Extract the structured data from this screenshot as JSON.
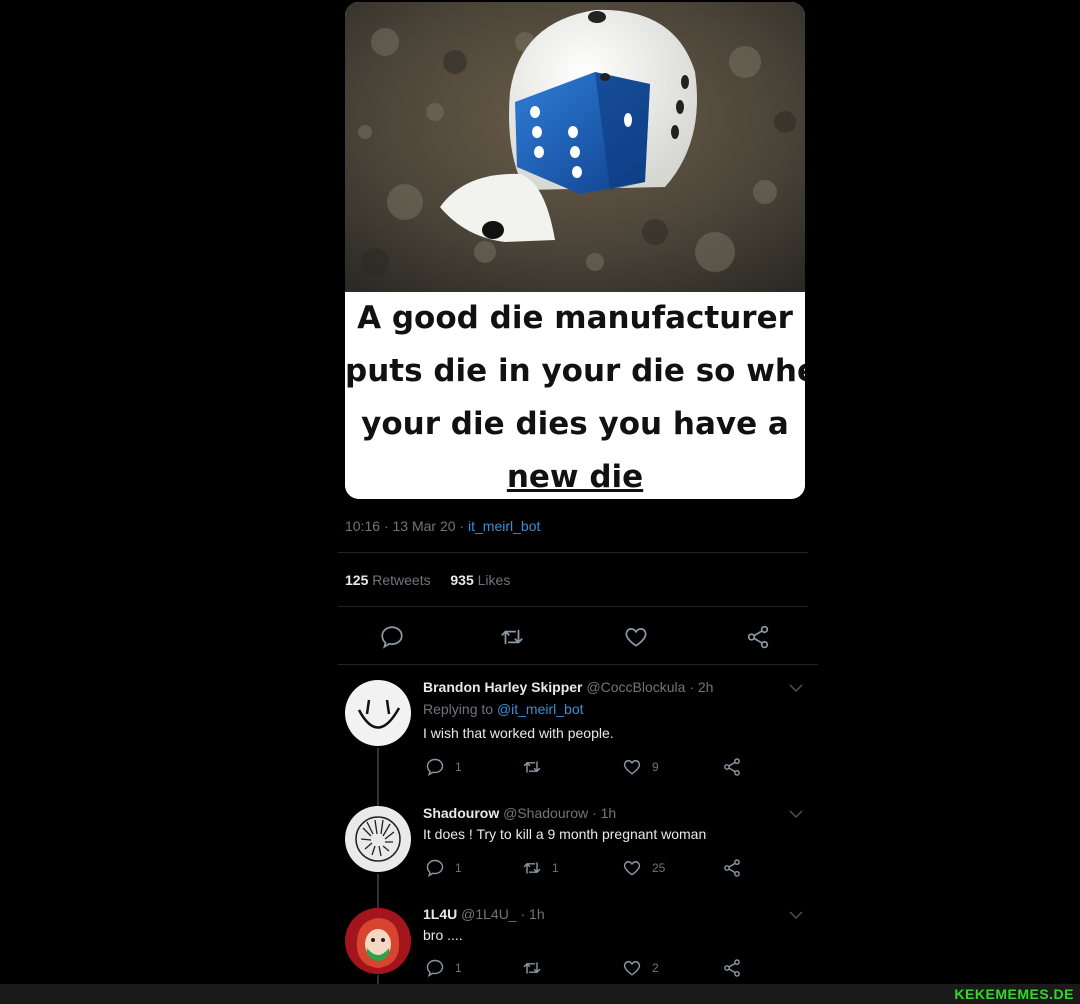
{
  "meme": {
    "caption_lines": [
      "A good die manufacturer",
      "puts die in your die so when",
      "your die dies you have a",
      "new die"
    ]
  },
  "tweet": {
    "time": "10:16",
    "date": "13 Mar 20",
    "source": "it_meirl_bot",
    "retweets_count": "125",
    "retweets_label": "Retweets",
    "likes_count": "935",
    "likes_label": "Likes"
  },
  "replies": [
    {
      "name": "Brandon Harley Skipper",
      "handle": "@CoccBlockula",
      "time": "2h",
      "replying_prefix": "Replying to",
      "replying_to": "@it_meirl_bot",
      "text": "I wish that worked with people.",
      "reply_count": "1",
      "retweet_count": "",
      "like_count": "9"
    },
    {
      "name": "Shadourow",
      "handle": "@Shadourow",
      "time": "1h",
      "text": "It does ! Try to kill a 9 month pregnant woman",
      "reply_count": "1",
      "retweet_count": "1",
      "like_count": "25"
    },
    {
      "name": "1L4U",
      "handle": "@1L4U_",
      "time": "1h",
      "text": "bro ....",
      "reply_count": "1",
      "retweet_count": "",
      "like_count": "2"
    }
  ],
  "colors": {
    "background": "#000000",
    "link": "#3b8fd6",
    "muted": "#6e767d",
    "watermark": "#37d62e"
  },
  "icons": [
    "comment-icon",
    "retweet-icon",
    "heart-icon",
    "share-icon",
    "chevron-down-icon"
  ],
  "watermark": "KEKEMEMES.DE"
}
